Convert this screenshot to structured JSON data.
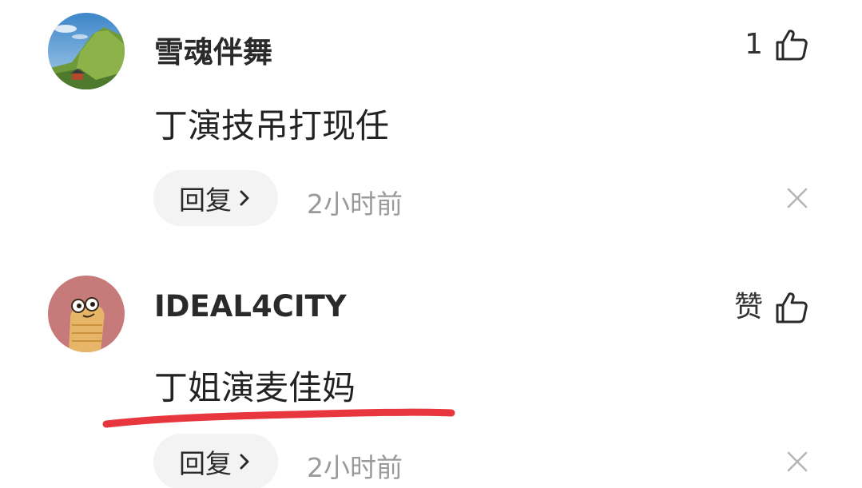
{
  "comments": [
    {
      "username": "雪魂伴舞",
      "like_label": "1",
      "text": "丁演技吊打现任",
      "reply_label": "回复",
      "time": "2小时前",
      "avatar_icon": "mountain-landscape-avatar",
      "liked_icon": "thumbs-up-icon"
    },
    {
      "username": "IDEAL4CITY",
      "like_label": "赞",
      "text": "丁姐演麦佳妈",
      "reply_label": "回复",
      "time": "2小时前",
      "avatar_icon": "cartoon-character-avatar",
      "liked_icon": "thumbs-up-icon",
      "highlight_color": "#e8363f"
    }
  ],
  "colors": {
    "background": "#ffffff",
    "reply_pill": "#f3f3f3",
    "muted_text": "#9a9a9a",
    "highlight": "#e8363f"
  }
}
